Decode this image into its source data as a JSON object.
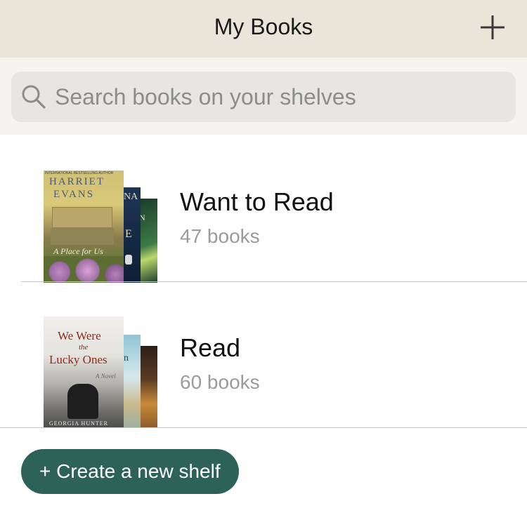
{
  "header": {
    "title": "My Books",
    "add_icon": "plus-icon"
  },
  "search": {
    "placeholder": "Search books on your shelves",
    "icon": "search-icon"
  },
  "shelves": [
    {
      "name": "Want to Read",
      "count": "47 books",
      "covers": [
        {
          "title_line1": "HARRIET",
          "title_line2": "EVANS",
          "subtitle": "A Place for Us",
          "top_text": "INTERNATIONAL BESTSELLING AUTHOR",
          "colors": [
            "#d9c978",
            "#8c7b4d",
            "#b58fb5"
          ]
        },
        {
          "visible_text_1": "NA",
          "visible_text_2": "E",
          "colors": [
            "#1d3556",
            "#0e1f35"
          ]
        },
        {
          "visible_text_1": "N",
          "colors": [
            "#1a3d2a",
            "#3e7a45"
          ]
        }
      ]
    },
    {
      "name": "Read",
      "count": "60 books",
      "covers": [
        {
          "title_line1": "We Were",
          "title_line2": "the",
          "title_line3": "Lucky Ones",
          "author": "GEORGIA HUNTER",
          "tagline": "A Novel",
          "colors": [
            "#e4e2dc",
            "#5a5a5a"
          ]
        },
        {
          "visible_text_1": "n",
          "colors": [
            "#8fc3d6",
            "#d7e9ee"
          ]
        },
        {
          "colors": [
            "#2b1e17",
            "#c98a3a"
          ]
        }
      ]
    }
  ],
  "footer": {
    "create_label": "+ Create a new shelf"
  },
  "colors": {
    "header_bg": "#e9e5d8",
    "accent": "#2c6258",
    "search_bg": "#e8e6e2"
  }
}
